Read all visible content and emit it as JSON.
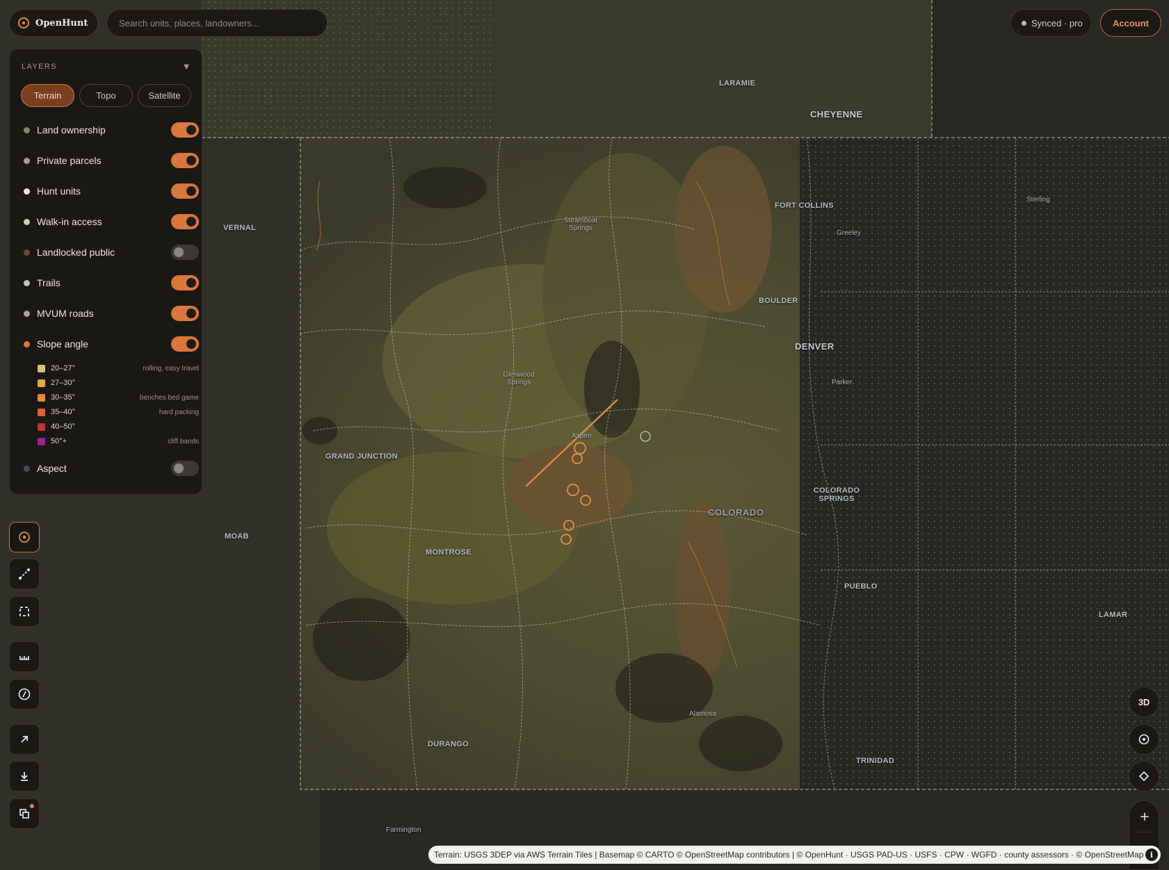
{
  "app": {
    "name": "OpenHunt"
  },
  "search": {
    "placeholder": "Search units, places, landowners..."
  },
  "status": {
    "sync_label": "Synced · pro"
  },
  "account": {
    "label": "Account"
  },
  "layers_panel": {
    "title": "LAYERS",
    "basemaps": [
      {
        "label": "Terrain",
        "active": true
      },
      {
        "label": "Topo",
        "active": false
      },
      {
        "label": "Satellite",
        "active": false
      }
    ],
    "layers": [
      {
        "label": "Land ownership",
        "on": true,
        "dot": "#7b8d5f"
      },
      {
        "label": "Private parcels",
        "on": true,
        "dot": "#a6a091"
      },
      {
        "label": "Hunt units",
        "on": true,
        "dot": "#e9e4da"
      },
      {
        "label": "Walk-in access",
        "on": true,
        "dot": "#c9d3b0"
      },
      {
        "label": "Landlocked public",
        "on": false,
        "dot": "#6a4a33"
      },
      {
        "label": "Trails",
        "on": true,
        "dot": "#c9c3b6"
      },
      {
        "label": "MVUM roads",
        "on": true,
        "dot": "#a9a59d"
      },
      {
        "label": "Slope angle",
        "on": true,
        "dot": "#d9773d"
      },
      {
        "label": "Aspect",
        "on": false,
        "dot": "#4c4866"
      }
    ],
    "slope_legend": [
      {
        "range": "20–27°",
        "note": "rolling, easy travel",
        "color": "#d8c07a"
      },
      {
        "range": "27–30°",
        "note": "",
        "color": "#e0a948"
      },
      {
        "range": "30–35°",
        "note": "benches bed game",
        "color": "#e08a3a"
      },
      {
        "range": "35–40°",
        "note": "hard packing",
        "color": "#d8623a"
      },
      {
        "range": "40–50°",
        "note": "",
        "color": "#c4322e"
      },
      {
        "range": "50°+",
        "note": "cliff bands",
        "color": "#8e2a8a"
      }
    ]
  },
  "tools": [
    {
      "icon": "locate-target-icon",
      "active": true
    },
    {
      "icon": "draw-line-icon"
    },
    {
      "icon": "draw-area-icon"
    },
    {
      "icon": "measure-ruler-icon"
    },
    {
      "icon": "compass-icon"
    },
    {
      "icon": "share-arrow-icon"
    },
    {
      "icon": "download-icon"
    },
    {
      "icon": "layers-stack-icon",
      "badge": true
    }
  ],
  "map_controls": {
    "view_3d_label": "3D",
    "zoom_in_label": "+"
  },
  "map": {
    "cities": [
      "CHEYENNE",
      "LARAMIE",
      "FORT COLLINS",
      "Greeley",
      "BOULDER",
      "DENVER",
      "Parker",
      "COLORADO SPRINGS",
      "PUEBLO",
      "TRINIDAD",
      "LAMAR",
      "Sterling",
      "Steamboat Springs",
      "Glenwood Springs",
      "Aspen",
      "GRAND JUNCTION",
      "MONTROSE",
      "DURANGO",
      "Alamosa",
      "VERNAL",
      "MOAB",
      "Farmington"
    ],
    "state_label": "COLORADO"
  },
  "attribution": "Terrain: USGS 3DEP via AWS Terrain Tiles | Basemap © CARTO © OpenStreetMap contributors | © OpenHunt · USGS PAD-US · USFS · CPW · WGFD · county assessors · © OpenStreetMap",
  "info_label": "i"
}
